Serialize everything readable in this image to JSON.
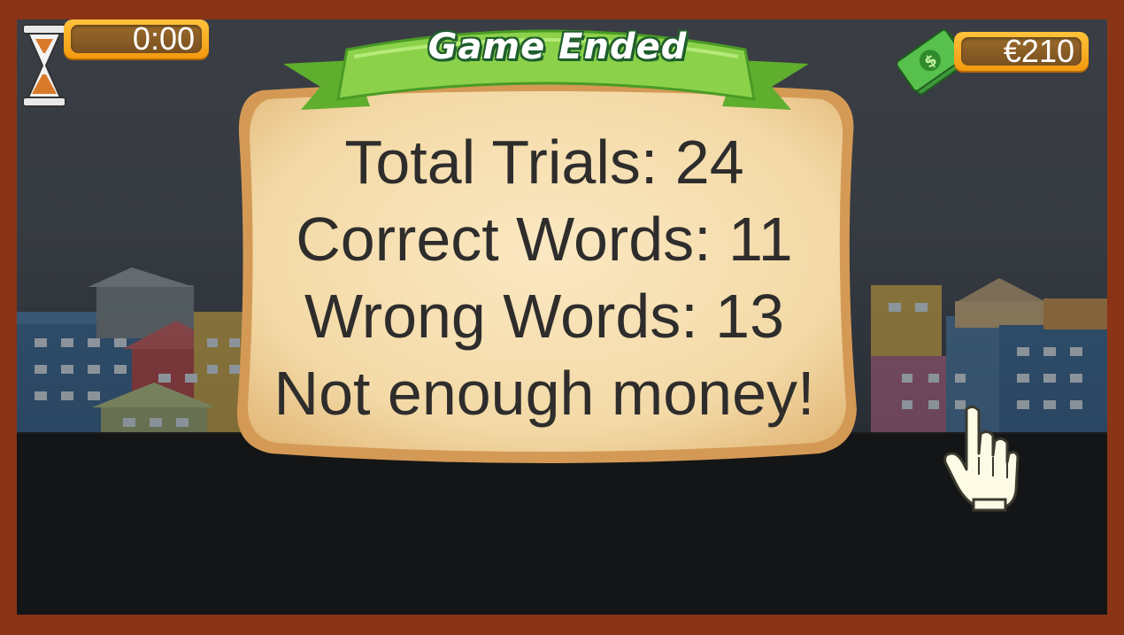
{
  "hud": {
    "timer": {
      "icon": "hourglass-icon",
      "value": "0:00"
    },
    "money": {
      "icon": "money-stack-icon",
      "value": "€210"
    }
  },
  "dialog": {
    "title": "Game Ended",
    "lines": [
      "Total Trials: 24",
      "Correct Words: 11",
      "Wrong Words: 13",
      "Not enough money!"
    ]
  },
  "pointer": {
    "icon": "hand-pointer-icon"
  },
  "colors": {
    "frame": "#8a3417",
    "hud_orange": "#f6a91c",
    "banner_green": "#7ecb3a",
    "panel": "#f6deb0",
    "text": "#2e2d2c"
  }
}
